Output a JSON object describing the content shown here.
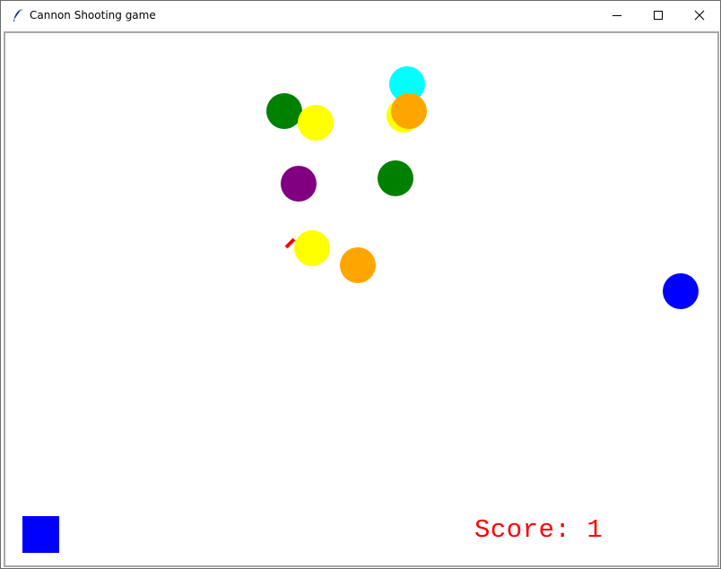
{
  "window": {
    "title": "Cannon Shooting game",
    "icon": "feather-icon",
    "controls": [
      "minimize-icon",
      "maximize-icon",
      "close-icon"
    ]
  },
  "game": {
    "score_text": "Score: 1",
    "score_color": "#ff0000",
    "gun_color": "#ff0000",
    "player_color": "#0000ff",
    "balls": [
      {
        "color": "#00ffff"
      },
      {
        "color": "#008000"
      },
      {
        "color": "#ffff00"
      },
      {
        "color": "#ffff00"
      },
      {
        "color": "#ffa500"
      },
      {
        "color": "#800080"
      },
      {
        "color": "#008000"
      },
      {
        "color": "#ffff00"
      },
      {
        "color": "#ffa500"
      },
      {
        "color": "#0000ff"
      }
    ]
  }
}
